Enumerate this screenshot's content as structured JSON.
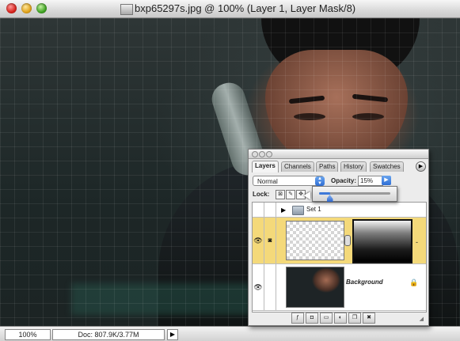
{
  "window": {
    "title": "bxp65297s.jpg @ 100% (Layer 1, Layer Mask/8)"
  },
  "status": {
    "zoom": "100%",
    "doc_size": "Doc: 807.9K/3.77M",
    "arrow": "▶"
  },
  "layers_panel": {
    "tabs": [
      {
        "label": "Layers",
        "active": true
      },
      {
        "label": "Channels",
        "active": false
      },
      {
        "label": "Paths",
        "active": false
      },
      {
        "label": "History",
        "active": false
      },
      {
        "label": "Swatches",
        "active": false
      }
    ],
    "menu_icon": "▶",
    "blend_mode": "Normal",
    "opacity_label": "Opacity:",
    "opacity_value": "15%",
    "opacity_fraction": 0.15,
    "lock_label": "Lock:",
    "rows": [
      {
        "type": "set",
        "name": "Set 1"
      },
      {
        "type": "layer",
        "name": "",
        "selected": true,
        "mask": true
      },
      {
        "type": "layer",
        "name": "Background",
        "locked": true
      }
    ]
  },
  "colors": {
    "selection": "#f4d97a",
    "accent": "#3e79d8"
  }
}
